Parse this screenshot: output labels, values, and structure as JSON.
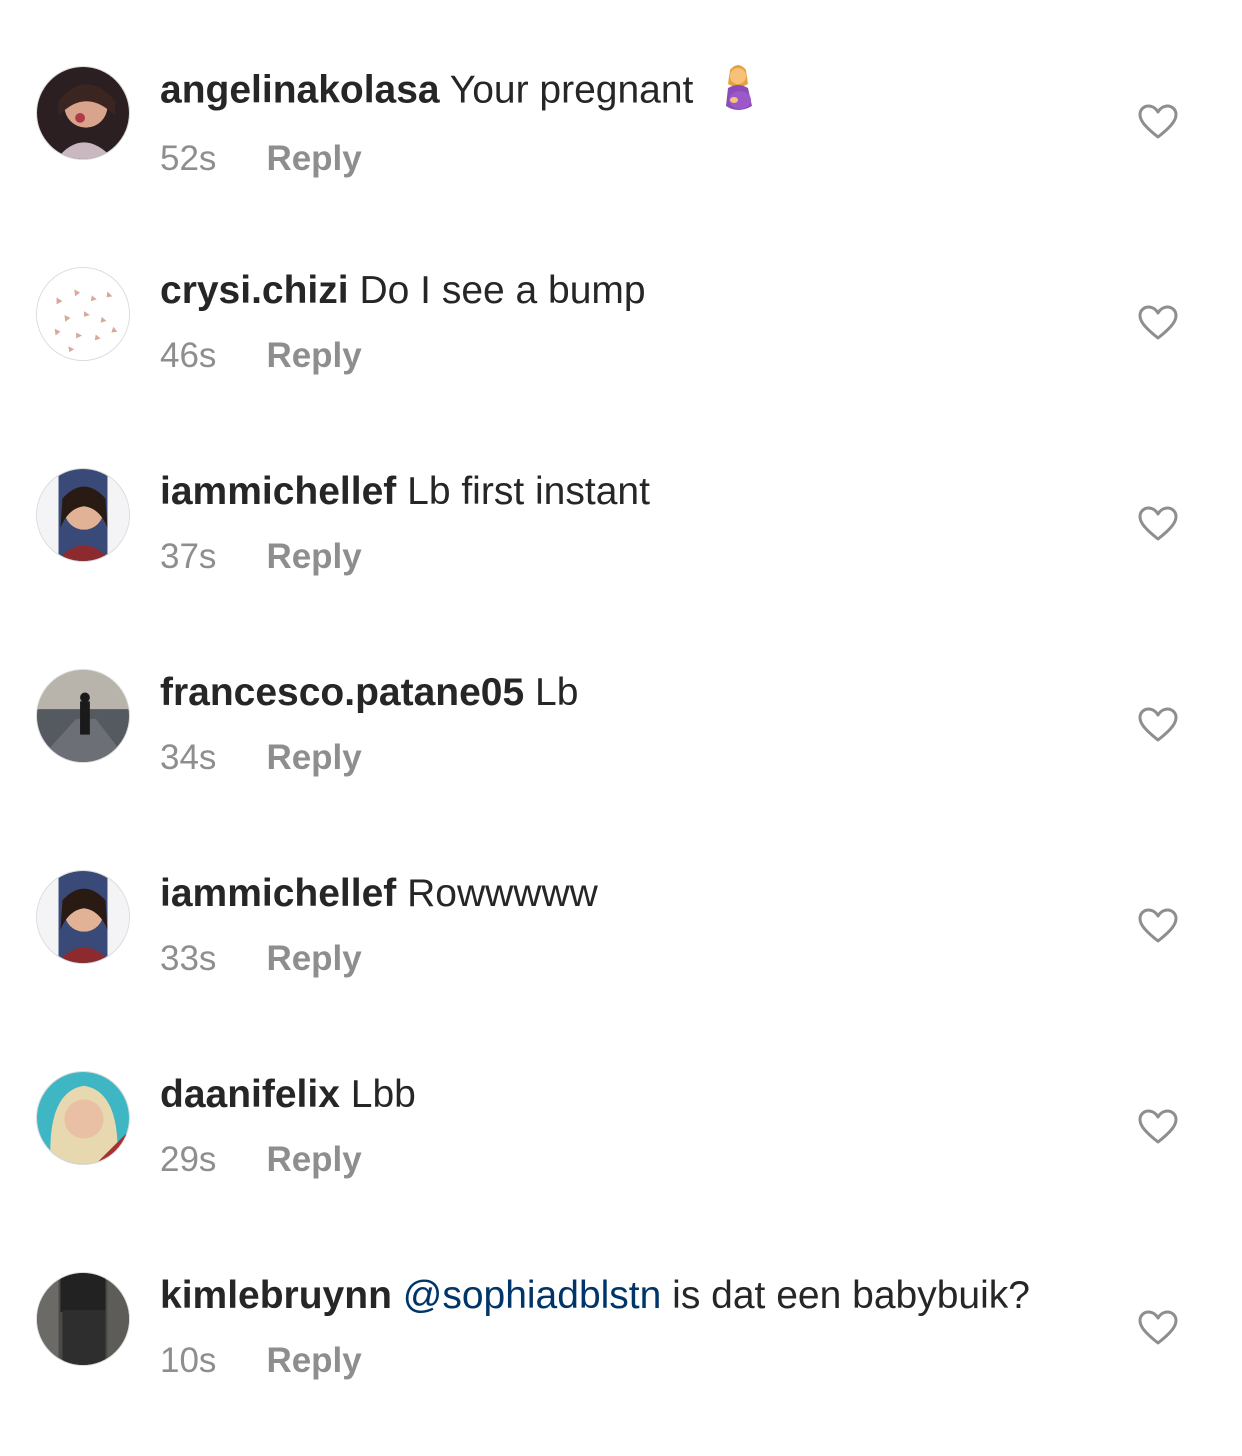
{
  "comments": [
    {
      "username": "angelinakolasa",
      "text": "Your pregnant",
      "emoji": "pregnant-woman-emoji",
      "time": "52s",
      "reply_label": "Reply"
    },
    {
      "username": "crysi.chizi",
      "text": "Do I see a bump",
      "time": "46s",
      "reply_label": "Reply"
    },
    {
      "username": "iammichellef",
      "text": "Lb first instant",
      "time": "37s",
      "reply_label": "Reply"
    },
    {
      "username": "francesco.patane05",
      "text": "Lb",
      "time": "34s",
      "reply_label": "Reply"
    },
    {
      "username": "iammichellef",
      "text": "Rowwwww",
      "time": "33s",
      "reply_label": "Reply"
    },
    {
      "username": "daanifelix",
      "text": "Lbb",
      "time": "29s",
      "reply_label": "Reply"
    },
    {
      "username": "kimlebruynn",
      "mention": "@sophiadblstn",
      "text": "is dat een babybuik?",
      "time": "10s",
      "reply_label": "Reply"
    }
  ],
  "icons": {
    "like": "heart-outline-icon"
  },
  "colors": {
    "text": "#262626",
    "meta": "#8e8e8e",
    "mention": "#003569",
    "heart": "#8e8e8e"
  }
}
